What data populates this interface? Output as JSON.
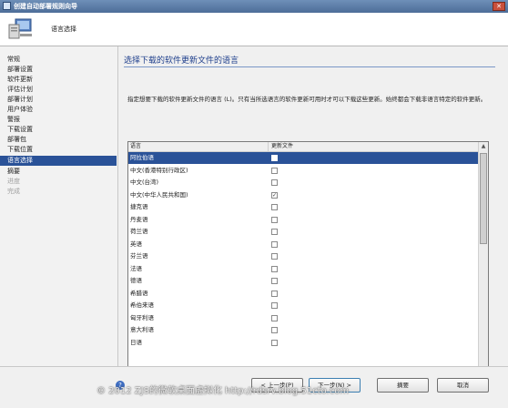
{
  "window": {
    "title": "创建自动部署规则向导",
    "close_glyph": "✕"
  },
  "header": {
    "page_label": "语言选择"
  },
  "sidebar": {
    "items": [
      {
        "label": "常规",
        "state": "normal"
      },
      {
        "label": "部署设置",
        "state": "normal"
      },
      {
        "label": "软件更新",
        "state": "normal"
      },
      {
        "label": "评估计划",
        "state": "normal"
      },
      {
        "label": "部署计划",
        "state": "normal"
      },
      {
        "label": "用户体验",
        "state": "normal"
      },
      {
        "label": "警报",
        "state": "normal"
      },
      {
        "label": "下载设置",
        "state": "normal"
      },
      {
        "label": "部署包",
        "state": "normal"
      },
      {
        "label": "下载位置",
        "state": "normal"
      },
      {
        "label": "语言选择",
        "state": "active"
      },
      {
        "label": "摘要",
        "state": "normal"
      },
      {
        "label": "进度",
        "state": "dim"
      },
      {
        "label": "完成",
        "state": "dim"
      }
    ]
  },
  "main": {
    "title": "选择下载的软件更新文件的语言",
    "description": "指定想要下载的软件更新文件的语言 (L)。只有当所选语言的软件更新可用时才可以下载这些更新。始终都会下载非语言特定的软件更新。",
    "list": {
      "col_language": "语言",
      "col_update_files": "更新文件",
      "rows": [
        {
          "language": "阿拉伯语",
          "checked": false,
          "selected": true
        },
        {
          "language": "中文(香港特别行政区)",
          "checked": false,
          "selected": false
        },
        {
          "language": "中文(台湾)",
          "checked": false,
          "selected": false
        },
        {
          "language": "中文(中华人民共和国)",
          "checked": true,
          "selected": false
        },
        {
          "language": "捷克语",
          "checked": false,
          "selected": false
        },
        {
          "language": "丹麦语",
          "checked": false,
          "selected": false
        },
        {
          "language": "荷兰语",
          "checked": false,
          "selected": false
        },
        {
          "language": "英语",
          "checked": false,
          "selected": false
        },
        {
          "language": "芬兰语",
          "checked": false,
          "selected": false
        },
        {
          "language": "法语",
          "checked": false,
          "selected": false
        },
        {
          "language": "德语",
          "checked": false,
          "selected": false
        },
        {
          "language": "希腊语",
          "checked": false,
          "selected": false
        },
        {
          "language": "希伯来语",
          "checked": false,
          "selected": false
        },
        {
          "language": "匈牙利语",
          "checked": false,
          "selected": false
        },
        {
          "language": "意大利语",
          "checked": false,
          "selected": false
        },
        {
          "language": "日语",
          "checked": false,
          "selected": false
        }
      ]
    }
  },
  "footer": {
    "help_glyph": "?",
    "prev_label": "< 上一步(P)",
    "next_label": "下一步(N) >",
    "summary_label": "摘要",
    "cancel_label": "取消"
  },
  "watermark": "© 2012 ZJS的微软桌面虚拟化 http://rdsrv.blog.51cto.com",
  "colors": {
    "accent": "#2a5298",
    "title": "#1f3f8c"
  }
}
